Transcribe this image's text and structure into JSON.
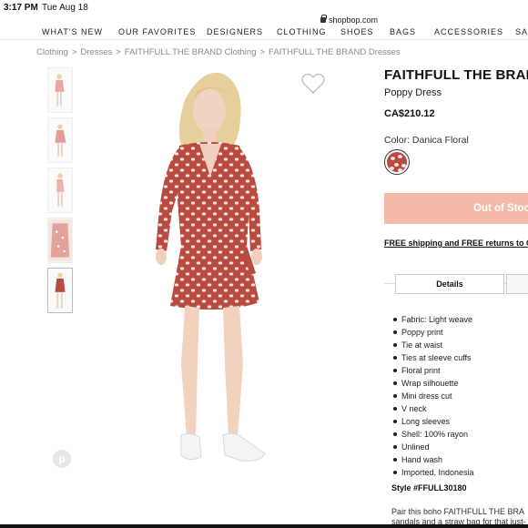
{
  "status_bar": {
    "time": "3:17 PM",
    "date": "Tue Aug 18"
  },
  "browser": {
    "url": "shopbop.com"
  },
  "nav": {
    "items": [
      "WHAT'S NEW",
      "OUR FAVORITES",
      "DESIGNERS",
      "CLOTHING",
      "SHOES",
      "BAGS",
      "ACCESSORIES",
      "SAL"
    ]
  },
  "breadcrumb": [
    "Clothing",
    "Dresses",
    "FAITHFULL THE BRAND Clothing",
    "FAITHFULL THE BRAND Dresses"
  ],
  "breadcrumb_separator": ">",
  "product": {
    "brand": "FAITHFULL THE BRAND",
    "name": "Poppy Dress",
    "price": "CA$210.12",
    "color_label": "Color: Danica Floral",
    "out_of_stock_label": "Out of Stoc",
    "shipping_text": "FREE shipping and FREE returns to Ca",
    "tab_details": "Details",
    "features": [
      "Fabric: Light weave",
      "Poppy print",
      "Tie at waist",
      "Ties at sleeve cuffs",
      "Floral print",
      "Wrap silhouette",
      "Mini dress cut",
      "V neck",
      "Long sleeves",
      "Shell: 100% rayon",
      "Unlined",
      "Hand wash",
      "Imported, Indonesia"
    ],
    "style_number": "Style #FFULL30180",
    "description_lines": [
      "Pair this boho FAITHFULL THE BRA",
      "sandals and a straw bag for that just-"
    ]
  },
  "icons": {
    "favorite": "heart-icon",
    "pinterest": "pinterest-icon",
    "lock": "lock-icon"
  },
  "pinterest_glyph": "p",
  "colors": {
    "dress_red": "#b84a3f",
    "out_of_stock_bg": "#f5b9a7",
    "text_dark": "#111111"
  }
}
